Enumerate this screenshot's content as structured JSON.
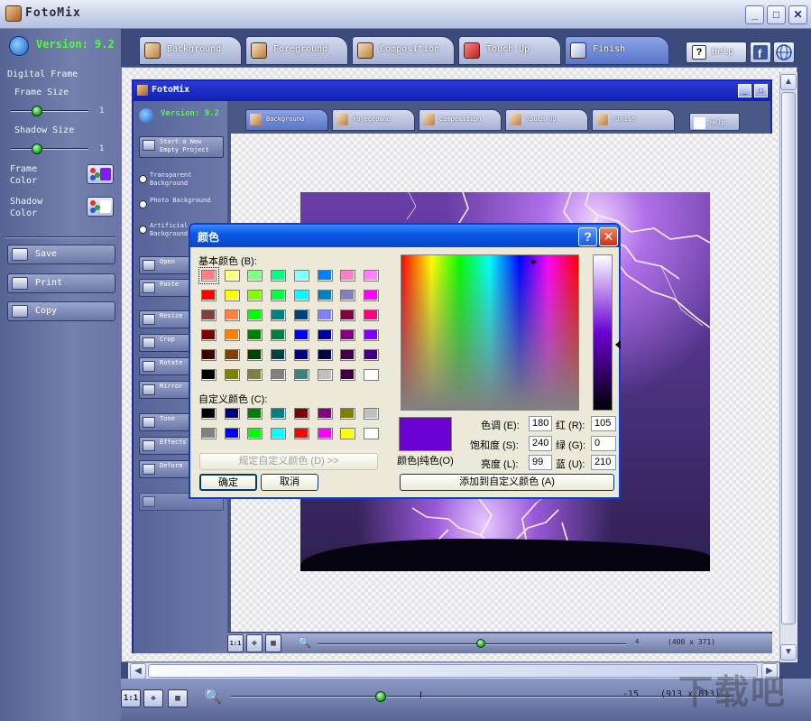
{
  "window": {
    "title": "FotoMix",
    "minimize": "_",
    "maximize": "□",
    "close": "✕"
  },
  "left": {
    "version": "Version: 9.2",
    "section_title": "Digital Frame",
    "frame_size_label": "Frame Size",
    "frame_size_value": "1",
    "shadow_size_label": "Shadow Size",
    "shadow_size_value": "1",
    "frame_color_label": "Frame Color",
    "shadow_color_label": "Shadow Color",
    "save": "Save",
    "print": "Print",
    "copy": "Copy"
  },
  "tabs": [
    {
      "label": "Background"
    },
    {
      "label": "Foreground"
    },
    {
      "label": "Composition"
    },
    {
      "label": "Touch Up"
    },
    {
      "label": "Finish"
    }
  ],
  "help": "Help",
  "inner": {
    "title": "FotoMix",
    "version": "Version: 9.2",
    "tabs": [
      "Background",
      "Foreground",
      "Composition",
      "Touch Up",
      "Finish"
    ],
    "help": "Help",
    "new_project": "Start a New Empty Project",
    "radio1": "Transparent Background",
    "radio2": "Photo Background",
    "radio3": "Artificial Background",
    "open": "Open",
    "paste": "Paste",
    "resize": "Resize",
    "crop": "Crop",
    "rotate": "Rotate",
    "mirror": "Mirror",
    "tone": "Tone",
    "effects": "Effects",
    "deform": "Deform",
    "zoom_value": "4",
    "dims": "(400 x 371)"
  },
  "bottom": {
    "zoom_value": "-15",
    "dims": "(913 x 813)",
    "btn_fit": "1:1"
  },
  "dialog": {
    "title": "颜色",
    "basic_colors_label": "基本颜色 (B):",
    "custom_colors_label": "自定义颜色 (C):",
    "define_custom": "规定自定义颜色 (D) >>",
    "ok": "确定",
    "cancel": "取消",
    "color_solid": "颜色|纯色(O)",
    "hue_label": "色调 (E):",
    "hue": "180",
    "sat_label": "饱和度 (S):",
    "sat": "240",
    "lum_label": "亮度 (L):",
    "lum": "99",
    "red_label": "红 (R):",
    "red": "105",
    "green_label": "绿 (G):",
    "green": "0",
    "blue_label": "蓝 (U):",
    "blue": "210",
    "add_custom": "添加到自定义颜色 (A)",
    "basic_colors": [
      "#ff8080",
      "#ffff80",
      "#80ff80",
      "#00ff80",
      "#80ffff",
      "#0080ff",
      "#ff80c0",
      "#ff80ff",
      "#ff0000",
      "#ffff00",
      "#80ff00",
      "#00ff40",
      "#00ffff",
      "#0080c0",
      "#8080c0",
      "#ff00ff",
      "#804040",
      "#ff8040",
      "#00ff00",
      "#008080",
      "#004080",
      "#8080ff",
      "#800040",
      "#ff0080",
      "#800000",
      "#ff8000",
      "#008000",
      "#008040",
      "#0000ff",
      "#0000a0",
      "#800080",
      "#8000ff",
      "#400000",
      "#804000",
      "#004000",
      "#004040",
      "#000080",
      "#000040",
      "#400040",
      "#400080",
      "#000000",
      "#808000",
      "#808040",
      "#808080",
      "#408080",
      "#c0c0c0",
      "#400040",
      "#ffffff"
    ],
    "custom_colors": [
      "#000000",
      "#000080",
      "#008000",
      "#008080",
      "#800000",
      "#800080",
      "#808000",
      "#c0c0c0",
      "#808080",
      "#0000ff",
      "#00ff00",
      "#00ffff",
      "#ff0000",
      "#ff00ff",
      "#ffff00",
      "#ffffff"
    ],
    "preview_color": "#6a00d2"
  },
  "watermark": "下载吧"
}
